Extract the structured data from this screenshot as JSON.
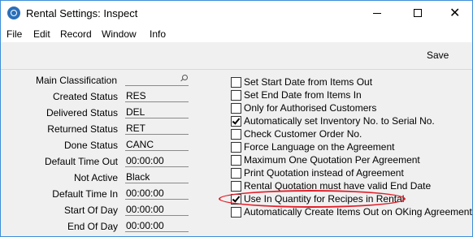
{
  "window": {
    "title": "Rental Settings: Inspect",
    "minimize_glyph": "—",
    "maximize_glyph": "☐",
    "close_glyph": "✕"
  },
  "menu": [
    "File",
    "Edit",
    "Record",
    "Window",
    "Info"
  ],
  "toolbar": {
    "save_label": "Save"
  },
  "fields": [
    {
      "label": "Main Classification",
      "value": ""
    },
    {
      "label": "Created Status",
      "value": "RES"
    },
    {
      "label": "Delivered Status",
      "value": "DEL"
    },
    {
      "label": "Returned Status",
      "value": "RET"
    },
    {
      "label": "Done Status",
      "value": "CANC"
    },
    {
      "label": "Default Time Out",
      "value": "00:00:00"
    },
    {
      "label": "Not Active",
      "value": "Black"
    },
    {
      "label": "Default Time In",
      "value": "00:00:00"
    },
    {
      "label": "Start Of Day",
      "value": "00:00:00"
    },
    {
      "label": "End Of Day",
      "value": "00:00:00"
    }
  ],
  "options": [
    {
      "label": "Set Start Date from Items Out",
      "checked": false
    },
    {
      "label": "Set End Date from Items In",
      "checked": false
    },
    {
      "label": "Only for Authorised Customers",
      "checked": false
    },
    {
      "label": "Automatically set Inventory No. to Serial No.",
      "checked": true
    },
    {
      "label": "Check Customer Order No.",
      "checked": false
    },
    {
      "label": "Force Language on the Agreement",
      "checked": false
    },
    {
      "label": "Maximum One Quotation Per Agreement",
      "checked": false
    },
    {
      "label": "Print Quotation instead of Agreement",
      "checked": false
    },
    {
      "label": "Rental Quotation must have valid End Date",
      "checked": false
    },
    {
      "label": "Use In Quantity for Recipes in Rental",
      "checked": true
    },
    {
      "label": "Automatically Create Items Out on OKing Agreement",
      "checked": false
    }
  ],
  "colors": {
    "highlight_ellipse": "#e0202a",
    "window_border": "#3c8fd9"
  }
}
